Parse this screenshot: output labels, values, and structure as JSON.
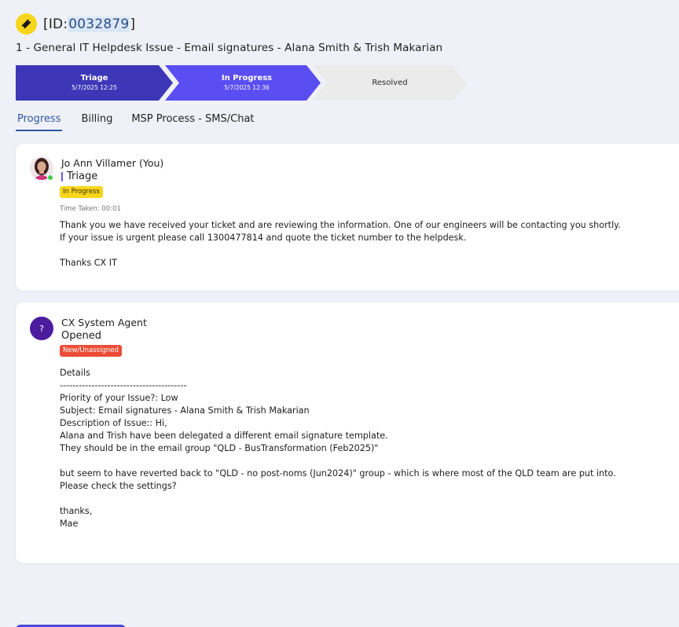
{
  "ticket": {
    "id_prefix": "[ID:",
    "id_number": "0032879",
    "id_suffix": "]",
    "subject": "1 - General IT Helpdesk Issue - Email signatures - Alana Smith & Trish Makarian",
    "icon": "ticket-icon"
  },
  "stages": [
    {
      "name": "Triage",
      "date": "5/7/2025 12:25",
      "status": "completed",
      "color": "#3d37b8"
    },
    {
      "name": "In Progress",
      "date": "5/7/2025 12:36",
      "status": "current",
      "color": "#5a4df2"
    },
    {
      "name": "Resolved",
      "date": "",
      "status": "pending",
      "color": "#ebebeb"
    }
  ],
  "tabs": [
    {
      "label": "Progress",
      "active": true
    },
    {
      "label": "Billing",
      "active": false
    },
    {
      "label": "MSP Process - SMS/Chat",
      "active": false
    }
  ],
  "entries": [
    {
      "author": "Jo Ann Villamer (You)",
      "stage": "Triage",
      "badge": "In Progress",
      "time_taken": "Time Taken: 00:01",
      "message": "Thank you we have received your ticket and are reviewing the information. One of our engineers will be contacting you shortly.\nIf your issue is urgent please call 1300477814 and quote the ticket number to the helpdesk.\n\nThanks CX IT"
    },
    {
      "author": "CX System Agent",
      "avatar_text": "?",
      "stage": "Opened",
      "badge": "New/Unassigned",
      "message": "Details\n----------------------------------------\nPriority of your Issue?: Low\nSubject: Email signatures - Alana Smith & Trish Makarian\nDescription of Issue:: Hi,\nAlana and Trish have been delegated a different email signature template.\nThey should be in the email group \"QLD - BusTransformation (Feb2025)\"\n\nbut seem to have reverted back to \"QLD - no post-noms (Jun2024)\" group - which is where most of the QLD team are put into.\nPlease check the settings?\n\nthanks,\nMae"
    }
  ],
  "colors": {
    "accent": "#2d57a0",
    "badge_in_progress": "#f8d51b",
    "badge_new": "#ec4c36",
    "ticket_icon_bg": "#f7d51a"
  }
}
